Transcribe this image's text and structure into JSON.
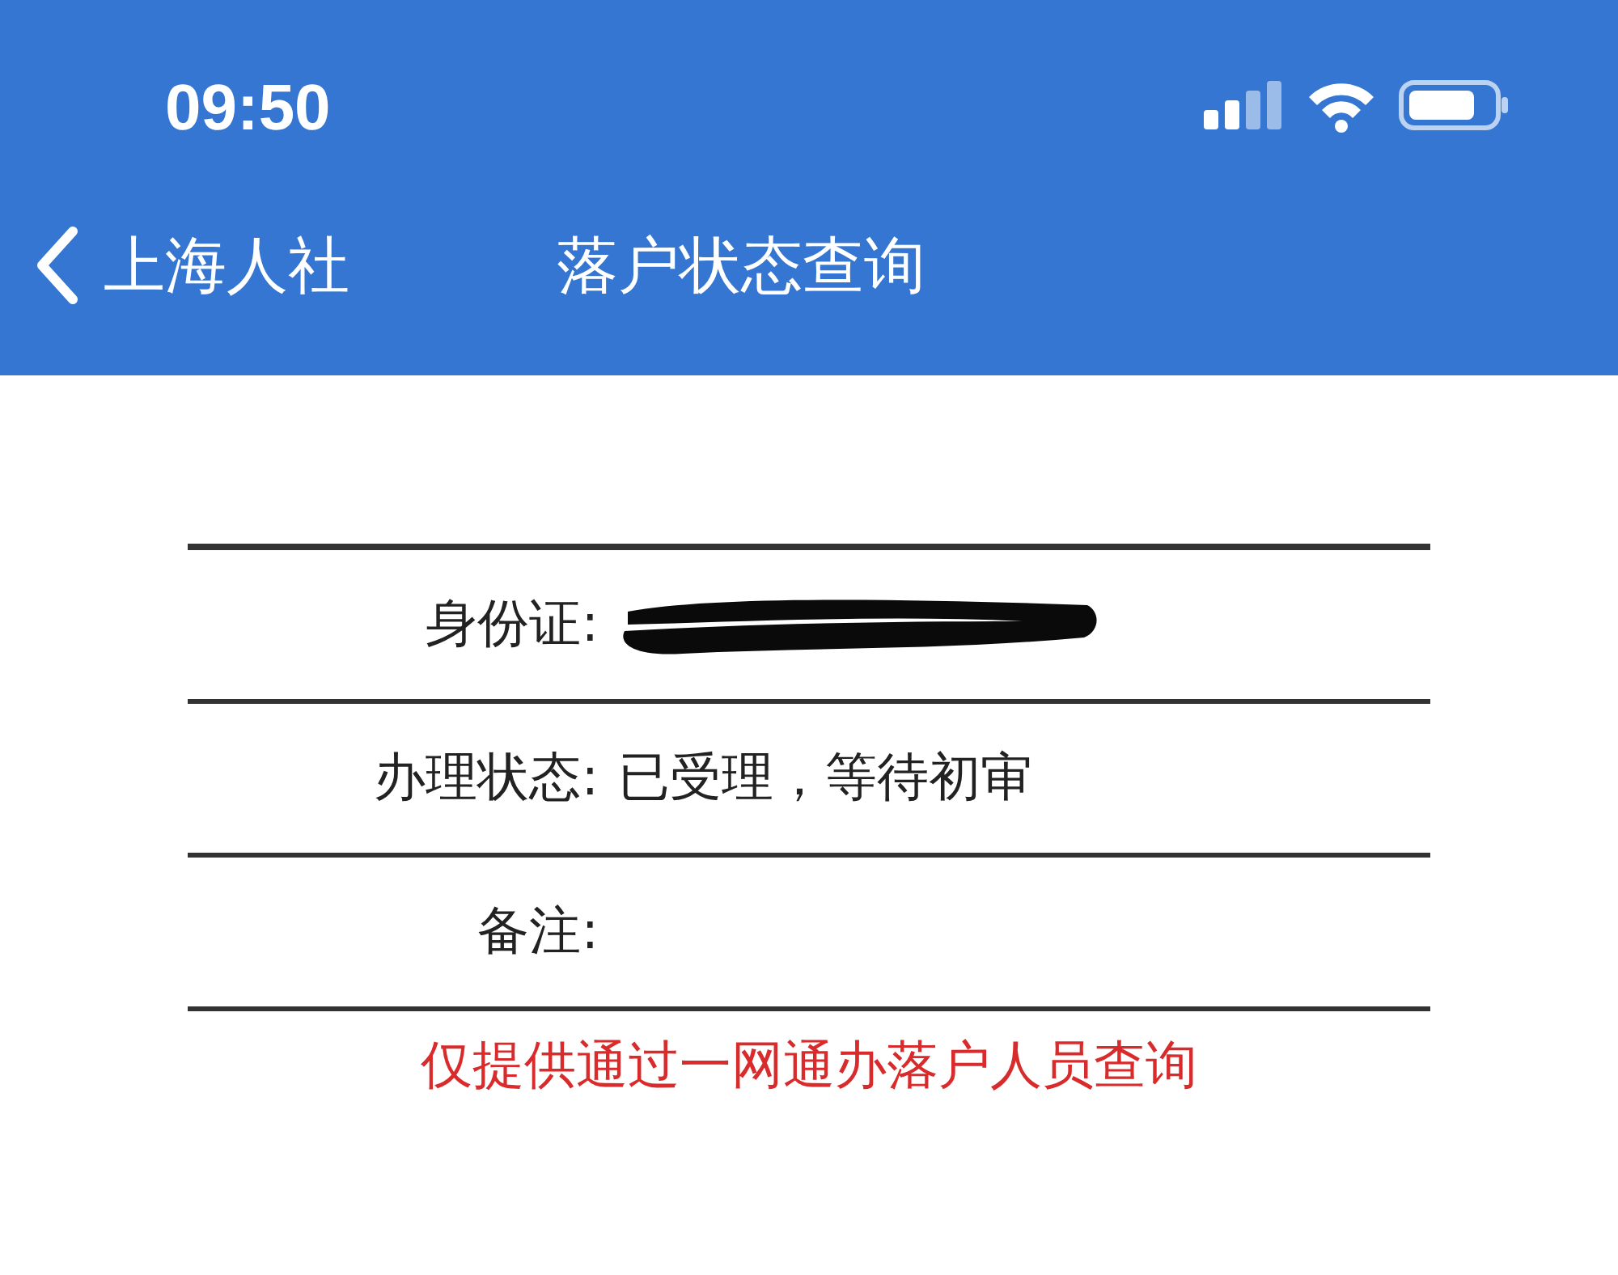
{
  "status_bar": {
    "time": "09:50"
  },
  "nav_bar": {
    "back_label": "上海人社",
    "title": "落户状态查询"
  },
  "rows": [
    {
      "label": "身份证:",
      "redacted": true
    },
    {
      "label": "办理状态:",
      "value": "已受理，等待初审",
      "redacted": false
    },
    {
      "label": "备注:",
      "redacted": false
    }
  ],
  "notice": "仅提供通过一网通办落户人员查询"
}
